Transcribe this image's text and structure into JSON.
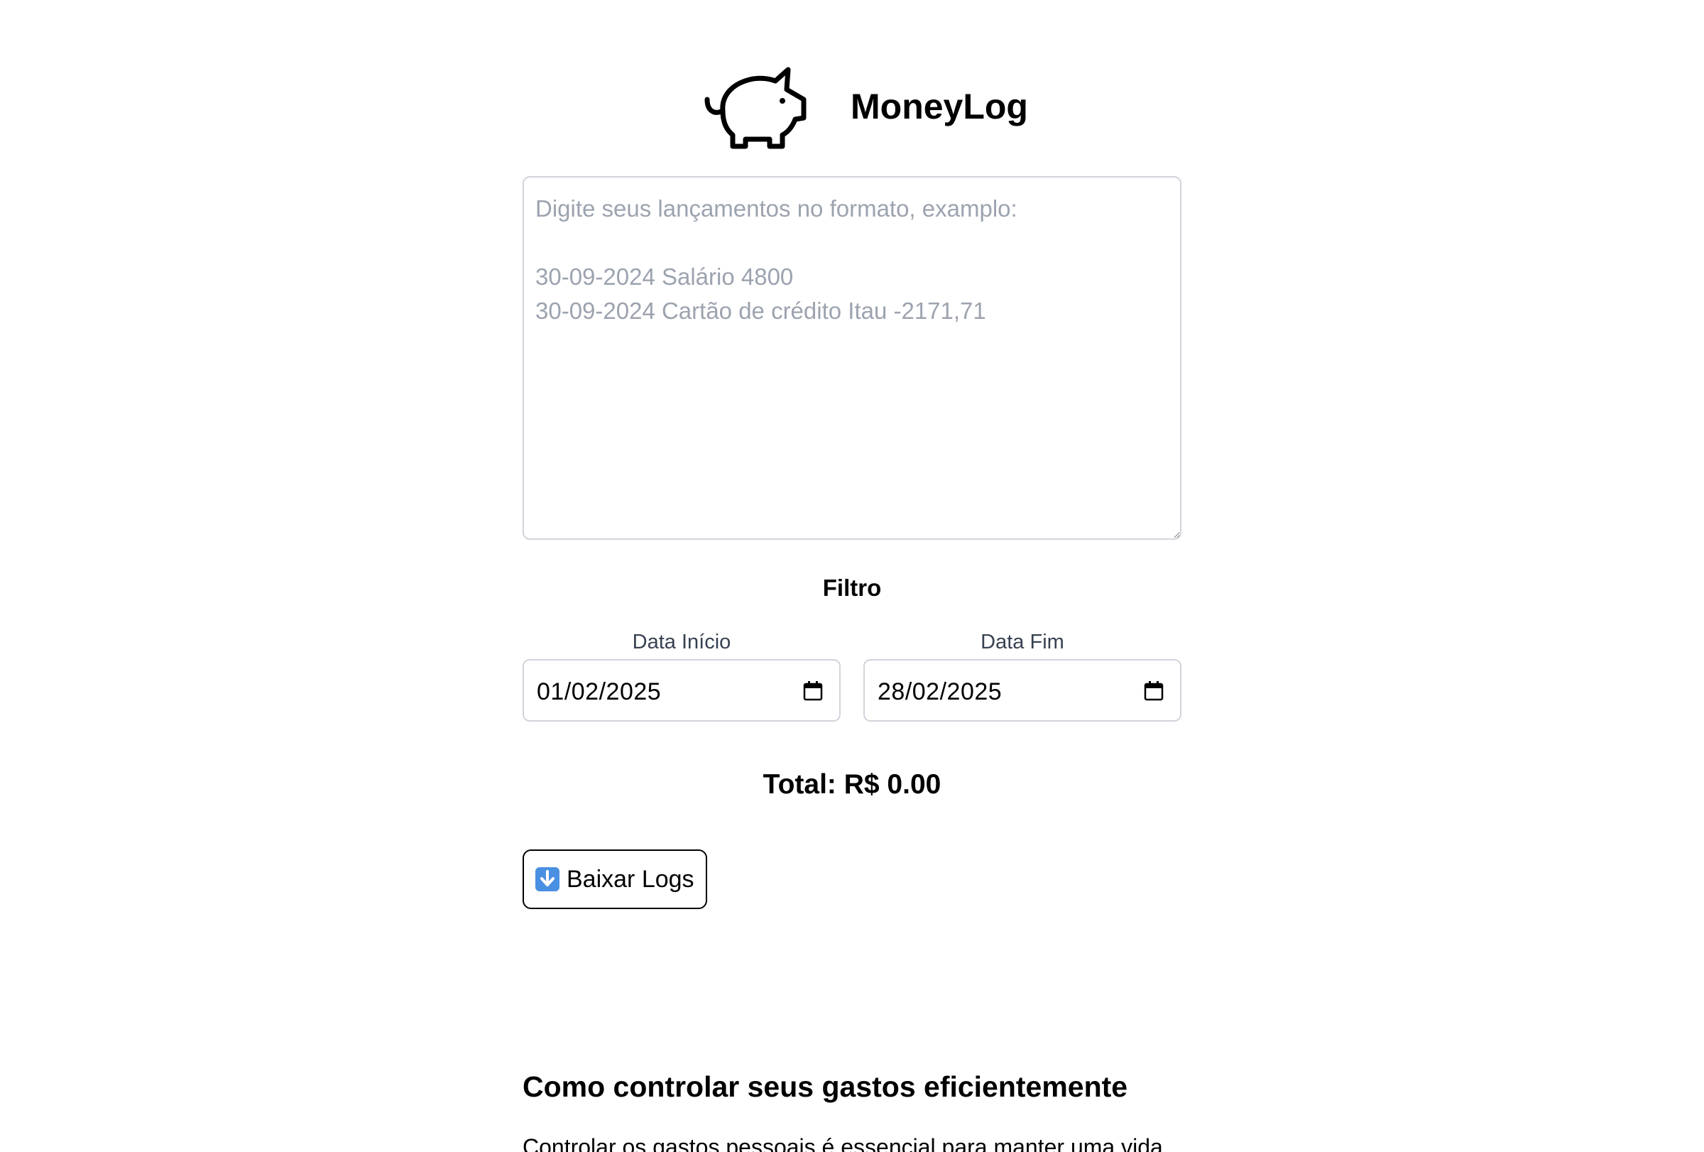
{
  "app": {
    "title": "MoneyLog",
    "logo_icon": "piggy-bank-icon"
  },
  "entries": {
    "value": "",
    "placeholder": "Digite seus lançamentos no formato, examplo:\n\n30-09-2024 Salário 4800\n30-09-2024 Cartão de crédito Itau -2171,71"
  },
  "filter": {
    "title": "Filtro",
    "start_label": "Data Início",
    "start_value": "01/02/2025",
    "end_label": "Data Fim",
    "end_value": "28/02/2025",
    "calendar_icon": "calendar-icon"
  },
  "summary": {
    "total": "Total: R$ 0.00"
  },
  "actions": {
    "download_label": "Baixar Logs",
    "download_icon": "download-arrow-icon",
    "download_icon_color": "#4a90e2"
  },
  "article": {
    "title": "Como controlar seus gastos eficientemente",
    "intro": "Controlar os gastos pessoais é essencial para manter uma vida"
  }
}
